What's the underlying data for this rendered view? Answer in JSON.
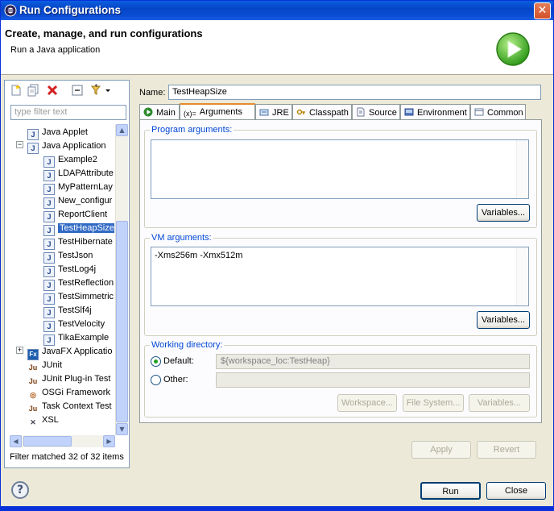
{
  "window": {
    "title": "Run Configurations",
    "close_glyph": "✕"
  },
  "header": {
    "title": "Create, manage, and run configurations",
    "description": "Run a Java application",
    "icon": "run-icon"
  },
  "left": {
    "filter_placeholder": "type filter text",
    "tree": [
      {
        "label": "Java Applet",
        "icon": "J"
      },
      {
        "label": "Java Application",
        "icon": "J"
      },
      {
        "label": "Example2",
        "icon": "J"
      },
      {
        "label": "LDAPAttribute",
        "icon": "J"
      },
      {
        "label": "MyPatternLay",
        "icon": "J"
      },
      {
        "label": "New_configur",
        "icon": "J"
      },
      {
        "label": "ReportClient",
        "icon": "J"
      },
      {
        "label": "TestHeapSize",
        "icon": "J"
      },
      {
        "label": "TestHibernate",
        "icon": "J"
      },
      {
        "label": "TestJson",
        "icon": "J"
      },
      {
        "label": "TestLog4j",
        "icon": "J"
      },
      {
        "label": "TestReflection",
        "icon": "J"
      },
      {
        "label": "TestSimmetric",
        "icon": "J"
      },
      {
        "label": "TestSlf4j",
        "icon": "J"
      },
      {
        "label": "TestVelocity",
        "icon": "J"
      },
      {
        "label": "TikaExample",
        "icon": "J"
      },
      {
        "label": "JavaFX Applicatio",
        "icon": "Fx"
      },
      {
        "label": "JUnit",
        "icon": "Ju"
      },
      {
        "label": "JUnit Plug-in Test",
        "icon": "Ju"
      },
      {
        "label": "OSGi Framework",
        "icon": "◎"
      },
      {
        "label": "Task Context Test",
        "icon": "Ju"
      },
      {
        "label": "XSL",
        "icon": "✕"
      }
    ],
    "status": "Filter matched 32 of 32 items"
  },
  "config": {
    "name_label": "Name:",
    "name_value": "TestHeapSize",
    "tabs": [
      {
        "label": "Main"
      },
      {
        "label": "Arguments"
      },
      {
        "label": "JRE"
      },
      {
        "label": "Classpath"
      },
      {
        "label": "Source"
      },
      {
        "label": "Environment"
      },
      {
        "label": "Common"
      }
    ],
    "program_arguments_label": "Program arguments:",
    "program_arguments_value": "",
    "vm_arguments_label": "VM arguments:",
    "vm_arguments_value": "-Xms256m -Xmx512m",
    "variables_label": "Variables...",
    "working_directory_label": "Working directory:",
    "default_label": "Default:",
    "default_value": "${workspace_loc:TestHeap}",
    "other_label": "Other:",
    "workspace_btn": "Workspace...",
    "filesystem_btn": "File System...",
    "variables_btn": "Variables...",
    "apply_label": "Apply",
    "revert_label": "Revert"
  },
  "footer": {
    "help_glyph": "?",
    "run_label": "Run",
    "close_label": "Close"
  }
}
